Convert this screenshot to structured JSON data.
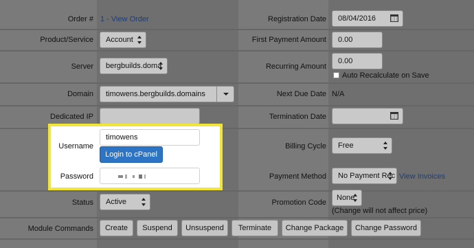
{
  "left": {
    "order_label": "Order #",
    "order_value": "1 - View Order",
    "product_label": "Product/Service",
    "product_value": "Account",
    "server_label": "Server",
    "server_value": "bergbuilds.doma",
    "domain_label": "Domain",
    "domain_value": "timowens.bergbuilds.domains",
    "dedicated_ip_label": "Dedicated IP",
    "dedicated_ip_value": "",
    "username_label": "Username",
    "username_value": "timowens",
    "login_button": "Login to cPanel",
    "password_label": "Password",
    "status_label": "Status",
    "status_value": "Active"
  },
  "right": {
    "registration_label": "Registration Date",
    "registration_value": "08/04/2016",
    "first_payment_label": "First Payment Amount",
    "first_payment_value": "0.00",
    "recurring_label": "Recurring Amount",
    "recurring_value": "0.00",
    "auto_recalc_label": "Auto Recalculate on Save",
    "next_due_label": "Next Due Date",
    "next_due_value": "N/A",
    "termination_label": "Termination Date",
    "termination_value": "",
    "billing_cycle_label": "Billing Cycle",
    "billing_cycle_value": "Free",
    "payment_method_label": "Payment Method",
    "payment_method_value": "No Payment Rec",
    "view_invoices": "View Invoices",
    "promotion_label": "Promotion Code",
    "promotion_value": "None",
    "promotion_note": "(Change will not affect price)"
  },
  "module_commands": {
    "label": "Module Commands",
    "buttons": [
      "Create",
      "Suspend",
      "Unsuspend",
      "Terminate",
      "Change Package",
      "Change Password"
    ]
  },
  "colors": {
    "highlight_border": "#f1e43a",
    "primary_button": "#2e74c4",
    "link": "#1c3d78"
  }
}
